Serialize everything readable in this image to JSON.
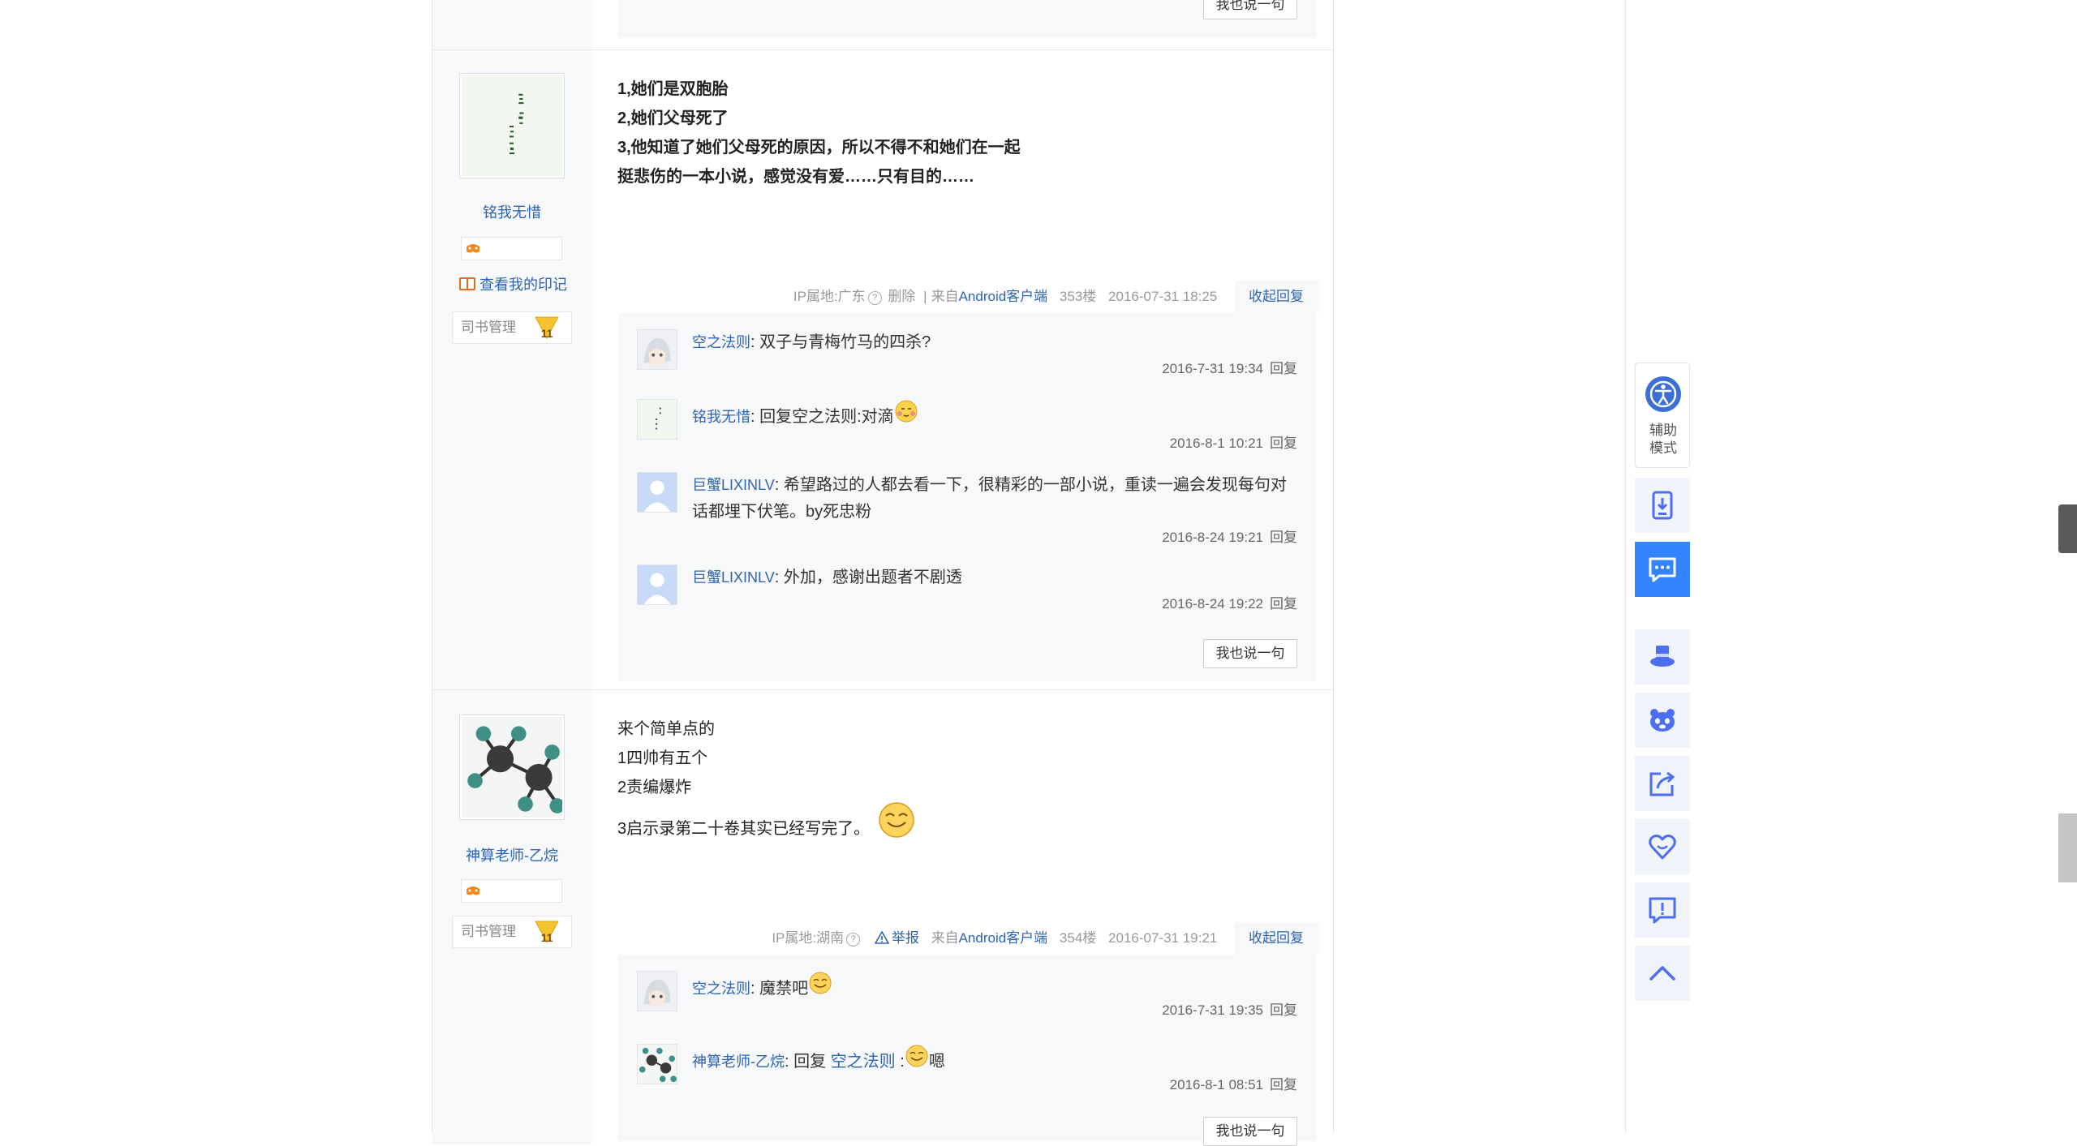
{
  "prev_post": {
    "say_label": "我也说一句"
  },
  "posts": [
    {
      "username": "铭我无惜",
      "imprint": "查看我的印记",
      "admin": "司书管理",
      "level": "11",
      "lines": [
        "1,她们是双胞胎",
        "2,她们父母死了",
        "3,他知道了她们父母死的原因，所以不得不和她们在一起",
        "挺悲伤的一本小说，感觉没有爱……只有目的……"
      ],
      "tail": {
        "ip": "IP属地:广东",
        "delete": "删除",
        "divider": "|",
        "from": "来自",
        "client": "Android客户端",
        "floor": "353楼",
        "time": "2016-07-31 18:25",
        "collapse": "收起回复"
      },
      "replies": [
        {
          "name": "空之法则",
          "text": "双子与青梅竹马的四杀?",
          "time": "2016-7-31 19:34",
          "reply": "回复"
        },
        {
          "name": "铭我无惜",
          "text": "回复空之法则:对滴",
          "time": "2016-8-1 10:21",
          "reply": "回复"
        },
        {
          "name": "巨蟹LIXINLV",
          "text": "希望路过的人都去看一下，很精彩的一部小说，重读一遍会发现每句对话都埋下伏笔。by死忠粉",
          "time": "2016-8-24 19:21",
          "reply": "回复"
        },
        {
          "name": "巨蟹LIXINLV",
          "text": "外加，感谢出题者不剧透",
          "time": "2016-8-24 19:22",
          "reply": "回复"
        }
      ],
      "say_label": "我也说一句"
    },
    {
      "username": "神算老师-乙烷",
      "admin": "司书管理",
      "level": "11",
      "lines": [
        "来个简单点的",
        "1四帅有五个",
        "2责编爆炸",
        "3启示录第二十卷其实已经写完了。"
      ],
      "tail": {
        "ip": "IP属地:湖南",
        "report": "举报",
        "from": "来自",
        "client": "Android客户端",
        "floor": "354楼",
        "time": "2016-07-31 19:21",
        "collapse": "收起回复"
      },
      "replies": [
        {
          "name": "空之法则",
          "text": "魔禁吧",
          "time": "2016-7-31 19:35",
          "reply": "回复"
        },
        {
          "name": "神算老师-乙烷",
          "text_prefix": "回复",
          "text_link": "空之法则",
          "text_sep": ":",
          "text_suffix": "嗯",
          "time": "2016-8-1 08:51",
          "reply": "回复"
        }
      ],
      "say_label": "我也说一句"
    }
  ],
  "sidebar": {
    "assist_label": "辅助模式",
    "icons": [
      "download-icon",
      "comment-icon",
      "hat-icon",
      "mascot-icon",
      "share-icon",
      "heart-icon",
      "report-icon",
      "back-to-top-icon"
    ]
  },
  "colors": {
    "link": "#2d64b3",
    "accent": "#3385ff",
    "panel": "#f7f8fa"
  }
}
